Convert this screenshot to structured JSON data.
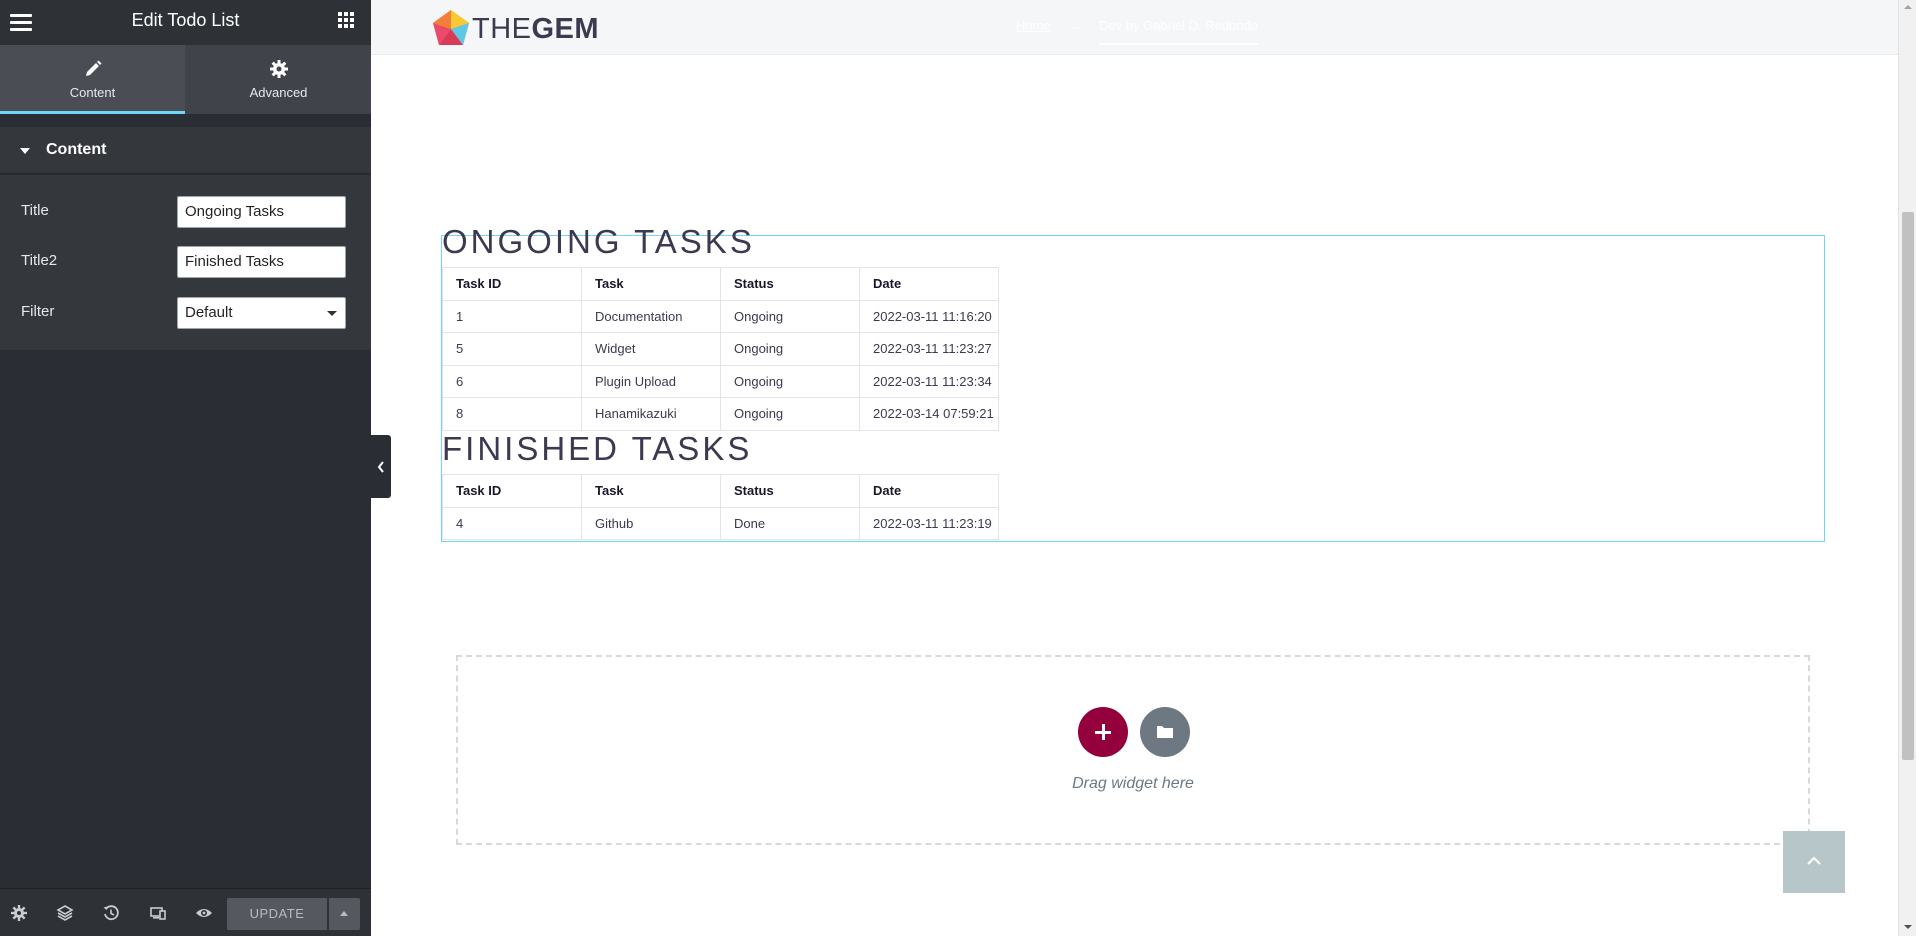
{
  "panel": {
    "title": "Edit Todo List",
    "tabs": [
      {
        "label": "Content",
        "icon": "pencil-icon",
        "active": true
      },
      {
        "label": "Advanced",
        "icon": "gear-icon",
        "active": false
      }
    ],
    "section_title": "Content",
    "controls": {
      "title_label": "Title",
      "title_value": "Ongoing Tasks",
      "title2_label": "Title2",
      "title2_value": "Finished Tasks",
      "filter_label": "Filter",
      "filter_value": "Default"
    },
    "footer": {
      "icons": [
        "settings-icon",
        "layers-icon",
        "history-icon",
        "responsive-icon",
        "preview-icon"
      ],
      "update_label": "UPDATE"
    }
  },
  "site": {
    "logo_part1": "THE",
    "logo_part2": "GEM",
    "breadcrumb": {
      "home": "Home",
      "separator": "→",
      "current": "Dev by Gabriel D. Redondo"
    }
  },
  "widget": {
    "ongoing_title": "ONGOING TASKS",
    "finished_title": "FINISHED TASKS",
    "columns": [
      "Task ID",
      "Task",
      "Status",
      "Date"
    ],
    "ongoing_rows": [
      [
        "1",
        "Documentation",
        "Ongoing",
        "2022-03-11 11:16:20"
      ],
      [
        "5",
        "Widget",
        "Ongoing",
        "2022-03-11 11:23:27"
      ],
      [
        "6",
        "Plugin Upload",
        "Ongoing",
        "2022-03-11 11:23:34"
      ],
      [
        "8",
        "Hanamikazuki",
        "Ongoing",
        "2022-03-14 07:59:21"
      ]
    ],
    "finished_rows": [
      [
        "4",
        "Github",
        "Done",
        "2022-03-11 11:23:19"
      ]
    ]
  },
  "drop_zone": {
    "text": "Drag widget here"
  },
  "colors": {
    "accent_cyan": "#71d7f7",
    "add_button": "#93003c",
    "template_button": "#6d7882",
    "panel_bg": "#2a2d33"
  }
}
